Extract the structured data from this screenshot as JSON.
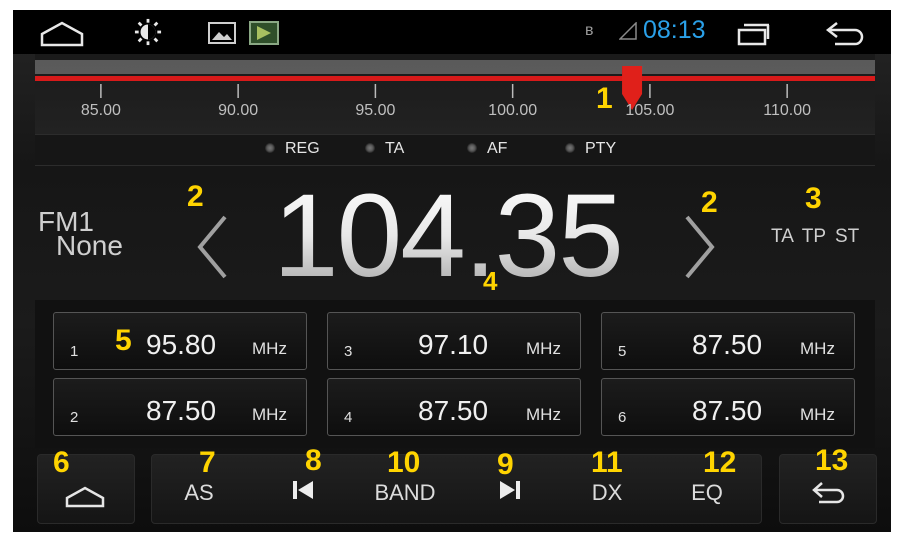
{
  "status_bar": {
    "home_icon": "home-outline-icon",
    "brightness_icon": "brightness-icon",
    "gallery_icon": "image-icon",
    "app_icon": "app-thumbnail-icon",
    "bluetooth": "ʙ",
    "signal_icon": "signal-triangle-icon",
    "time": "08:13",
    "recents_icon": "recent-apps-icon",
    "back_icon": "back-arrow-icon"
  },
  "scale": {
    "labels": [
      "85.00",
      "90.00",
      "95.00",
      "100.00",
      "105.00",
      "110.00"
    ],
    "current_mhz": 104.35,
    "range_mhz": [
      82.6,
      113.2
    ],
    "accent": "#d81a1a",
    "marker_color": "#e0201a"
  },
  "indicators": [
    "REG",
    "TA",
    "AF",
    "PTY"
  ],
  "display": {
    "band": "FM1",
    "station_name": "None",
    "frequency": "104.35",
    "flags": "TA TP ST"
  },
  "presets": [
    {
      "num": "1",
      "freq": "95.80",
      "unit": "MHz"
    },
    {
      "num": "2",
      "freq": "87.50",
      "unit": "MHz"
    },
    {
      "num": "3",
      "freq": "97.10",
      "unit": "MHz"
    },
    {
      "num": "4",
      "freq": "87.50",
      "unit": "MHz"
    },
    {
      "num": "5",
      "freq": "87.50",
      "unit": "MHz"
    },
    {
      "num": "6",
      "freq": "87.50",
      "unit": "MHz"
    }
  ],
  "bottom_bar": {
    "as_label": "AS",
    "band_label": "BAND",
    "dx_label": "DX",
    "eq_label": "EQ",
    "home_icon": "home-outline-icon",
    "prev_icon": "skip-previous-icon",
    "next_icon": "skip-next-icon",
    "back_icon": "back-arrow-icon"
  },
  "annotations": {
    "a1": "1",
    "a2": "2",
    "a3": "3",
    "a4": "4",
    "a5": "5",
    "a6": "6",
    "a7": "7",
    "a8": "8",
    "a9": "9",
    "a10": "10",
    "a11": "11",
    "a12": "12",
    "a13": "13"
  },
  "colors": {
    "accent_yellow": "#ffd400",
    "clock_blue": "#2aa0e8",
    "scale_red": "#d81a1a"
  }
}
